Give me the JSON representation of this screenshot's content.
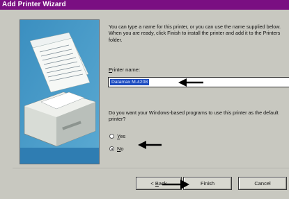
{
  "window": {
    "title": "Add Printer Wizard"
  },
  "intro_text": "You can type a name for this printer, or you can use the name supplied below. When you are ready, click Finish to install the printer and add it to the Printers folder.",
  "printer_name": {
    "label_underlined": "P",
    "label_rest": "rinter name:",
    "value": "Datamax M-4208"
  },
  "default_question": "Do you want your Windows-based programs to use this printer as the default printer?",
  "options": [
    {
      "label_underlined": "Y",
      "label_rest": "es",
      "selected": false
    },
    {
      "label_underlined": "N",
      "label_rest": "o",
      "selected": true
    }
  ],
  "buttons": {
    "back": {
      "prefix": "< ",
      "underlined": "B",
      "rest": "ack"
    },
    "finish": "Finish",
    "cancel": "Cancel"
  },
  "colors": {
    "titlebar": "#7a0f82",
    "dialog_bg": "#c8c8c0",
    "selection": "#1d4cc0",
    "illustration": "#4d9cc6"
  },
  "icons": [
    "printer-illustration",
    "arrow-annotation"
  ]
}
